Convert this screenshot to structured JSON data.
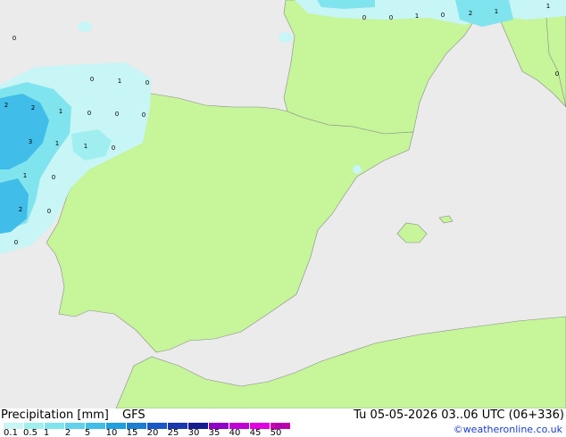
{
  "footer": {
    "title": "Precipitation [mm]",
    "model": "GFS",
    "datetime": "Tu 05-05-2026 03..06 UTC (06+336)",
    "credit": "©weatheronline.co.uk"
  },
  "legend": {
    "ticks": [
      "0.1",
      "0.5",
      "1",
      "2",
      "5",
      "10",
      "15",
      "20",
      "25",
      "30",
      "35",
      "40",
      "45",
      "50"
    ],
    "colors": [
      "#c8f5f5",
      "#a0eef0",
      "#80e4ee",
      "#60d2ec",
      "#40bde8",
      "#209fde",
      "#1c7ed0",
      "#1a58c8",
      "#1838b0",
      "#141c90",
      "#9000c8",
      "#c000d8",
      "#e000e0",
      "#c800a8"
    ]
  },
  "map_labels": [
    "0",
    "0",
    "0",
    "1",
    "0",
    "2",
    "1",
    "1",
    "0",
    "1",
    "0",
    "2",
    "2",
    "1",
    "0",
    "0",
    "0",
    "0",
    "3",
    "1",
    "1",
    "0",
    "1",
    "0",
    "2",
    "0",
    "0"
  ],
  "colors": {
    "land": "#c6f59a",
    "sea": "#ebebeb",
    "rain_light": "#c8f5f5",
    "rain_mid": "#80e4ee",
    "rain_heavy": "#40bde8"
  }
}
